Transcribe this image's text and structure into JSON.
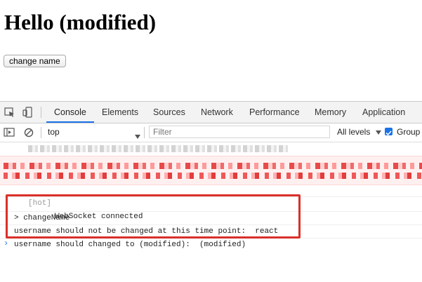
{
  "page": {
    "title": "Hello (modified)",
    "button_label": "change name"
  },
  "devtools": {
    "tabs": [
      {
        "label": "Console",
        "active": true
      },
      {
        "label": "Elements"
      },
      {
        "label": "Sources"
      },
      {
        "label": "Network"
      },
      {
        "label": "Performance"
      },
      {
        "label": "Memory"
      },
      {
        "label": "Application"
      }
    ],
    "toolbar": {
      "context": "top",
      "filter_placeholder": "Filter",
      "levels": "All levels",
      "group_label": "Group"
    },
    "console": {
      "hot_tag": "[hot]",
      "hot_message": "WebSocket connected",
      "command": "> changeName",
      "log_1": "username should not be changed at this time point:  react",
      "log_2": "username should changed to (modified):  (modified)",
      "prompt": "›"
    },
    "colors": {
      "accent": "#1a73e8",
      "highlight": "#d9302a",
      "error_bg": "#fff0f0"
    }
  }
}
